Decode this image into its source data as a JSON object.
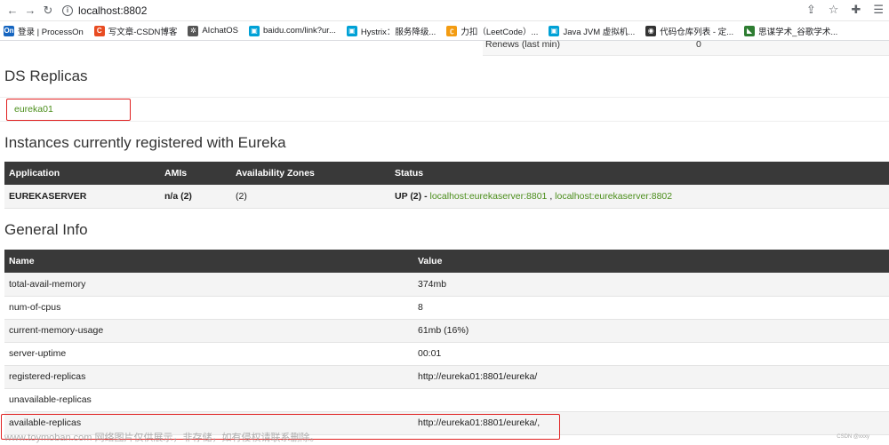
{
  "browser": {
    "url": "localhost:8802",
    "bookmarks": [
      {
        "label": "登录 | ProcessOn",
        "icon": "processon-icon",
        "color": "#1565c0",
        "glyph": "On"
      },
      {
        "label": "写文章-CSDN博客",
        "icon": "csdn-icon",
        "color": "#e84c22",
        "glyph": "C"
      },
      {
        "label": "AIchatOS",
        "icon": "openai-icon",
        "color": "#555555",
        "glyph": "✲"
      },
      {
        "label": "baidu.com/link?ur...",
        "icon": "bilibili-icon",
        "color": "#00a1d6",
        "glyph": "▣"
      },
      {
        "label": "Hystrix：服务降级...",
        "icon": "bilibili-icon",
        "color": "#00a1d6",
        "glyph": "▣"
      },
      {
        "label": "力扣（LeetCode）...",
        "icon": "leetcode-icon",
        "color": "#f39c12",
        "glyph": "ʗ"
      },
      {
        "label": "Java JVM 虚拟机...",
        "icon": "bilibili-icon",
        "color": "#00a1d6",
        "glyph": "▣"
      },
      {
        "label": "代码仓库列表 - 定...",
        "icon": "repo-icon",
        "color": "#333333",
        "glyph": "◉"
      },
      {
        "label": "思谋学术_谷歌学术...",
        "icon": "scholar-icon",
        "color": "#2e7d32",
        "glyph": "◣"
      }
    ]
  },
  "renews": {
    "label": "Renews (last min)",
    "value": "0"
  },
  "ds_replicas": {
    "heading": "DS Replicas",
    "replica": "eureka01"
  },
  "instances": {
    "heading": "Instances currently registered with Eureka",
    "columns": [
      "Application",
      "AMIs",
      "Availability Zones",
      "Status"
    ],
    "rows": [
      {
        "application": "EUREKASERVER",
        "amis": "n/a (2)",
        "zones": "(2)",
        "status_prefix": "UP (2) - ",
        "link1": "localhost:eurekaserver:8801",
        "separator": " , ",
        "link2": "localhost:eurekaserver:8802"
      }
    ]
  },
  "general_info": {
    "heading": "General Info",
    "columns": [
      "Name",
      "Value"
    ],
    "rows": [
      {
        "name": "total-avail-memory",
        "value": "374mb"
      },
      {
        "name": "num-of-cpus",
        "value": "8"
      },
      {
        "name": "current-memory-usage",
        "value": "61mb (16%)"
      },
      {
        "name": "server-uptime",
        "value": "00:01"
      },
      {
        "name": "registered-replicas",
        "value": "http://eureka01:8801/eureka/"
      },
      {
        "name": "unavailable-replicas",
        "value": ""
      },
      {
        "name": "available-replicas",
        "value": "http://eureka01:8801/eureka/,"
      }
    ]
  },
  "watermark": "www.toymoban.com 网络图片仅供展示，非存储，如有侵权请联系删除。",
  "corner_mark": "CSDN @xxxy",
  "colors": {
    "link_green": "#4b8e1b",
    "header_dark": "#393939",
    "highlight_red": "#e02020"
  }
}
